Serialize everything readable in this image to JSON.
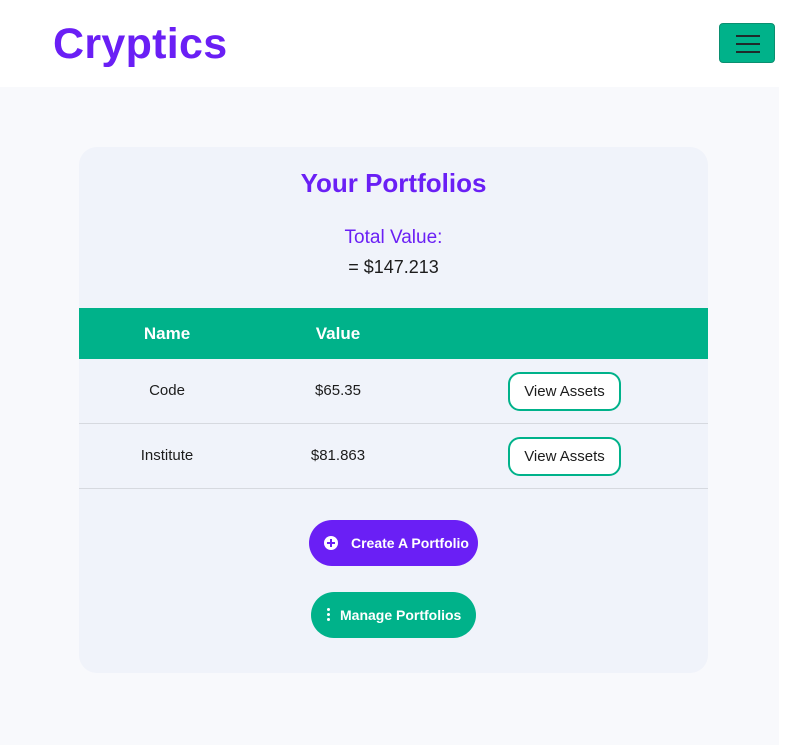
{
  "navbar": {
    "brand": "Cryptics",
    "menu_icon": "hamburger-menu-icon"
  },
  "portfolio_card": {
    "title": "Your Portfolios",
    "total_label": "Total Value:",
    "total_value": "= $147.213",
    "table": {
      "headers": [
        "Name",
        "Value",
        ""
      ],
      "rows": [
        {
          "name": "Code",
          "value": "$65.35",
          "action": "View Assets"
        },
        {
          "name": "Institute",
          "value": "$81.863",
          "action": "View Assets"
        }
      ]
    },
    "create_button": {
      "label": "Create A Portfolio",
      "icon": "plus-circle-icon"
    },
    "manage_button": {
      "label": "Manage Portfolios",
      "icon": "vertical-dots-icon"
    }
  },
  "colors": {
    "brand": "#6a1ff5",
    "accent": "#00b28a",
    "card_bg": "#f0f3fa",
    "page_bg": "#f8f9fc"
  }
}
